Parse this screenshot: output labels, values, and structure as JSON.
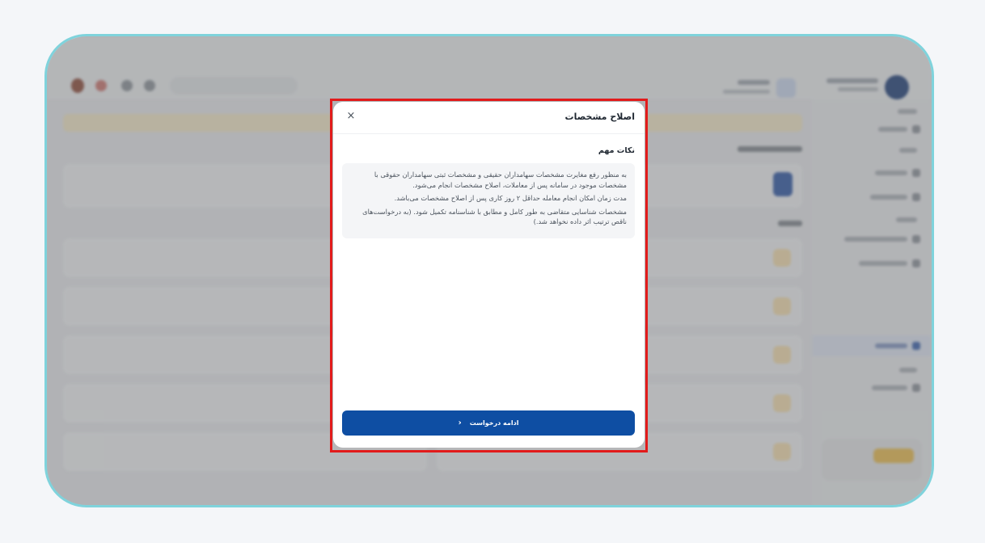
{
  "modal": {
    "title": "اصلاح مشخصات",
    "close_icon": "×",
    "section_title": "نکات مهم",
    "notes": [
      "به منظور رفع مغایرت مشخصات سهامداران حقیقی و مشخصات ثبتی سهامداران حقوقی با مشخصات موجود در سامانه پس از معاملات، اصلاح مشخصات انجام می‌شود.",
      "مدت زمان امکان انجام معامله حداقل ۲ روز کاری پس از اصلاح مشخصات می‌باشد.",
      "مشخصات شناسایی متقاضی به طور کامل و مطابق با شناسنامه تکمیل شود. (به درخواست‌های ناقص ترتیب اثر داده نخواهد شد.)"
    ],
    "cta_label": "ادامه درخواست",
    "cta_icon": "‹"
  },
  "colors": {
    "frame_border": "#7fd3dc",
    "highlight_outline": "#e21b1b",
    "primary": "#0e4ea3"
  }
}
